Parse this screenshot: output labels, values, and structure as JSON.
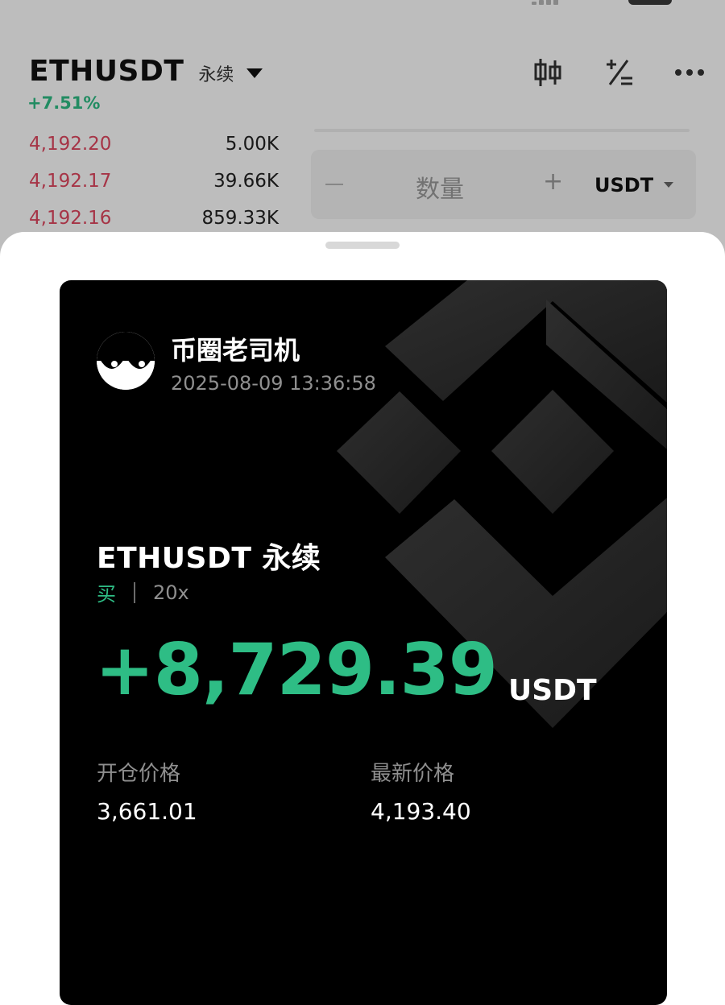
{
  "header": {
    "pair": "ETHUSDT",
    "contract_type": "永续",
    "change_percent": "+7.51%",
    "icons": [
      "candlestick-icon",
      "position-calc-icon",
      "more-icon"
    ]
  },
  "orderbook": {
    "asks": [
      {
        "price": "4,192.20",
        "qty": "5.00K"
      },
      {
        "price": "4,192.17",
        "qty": "39.66K"
      },
      {
        "price": "4,192.16",
        "qty": "859.33K"
      }
    ]
  },
  "order_form": {
    "quantity_placeholder": "数量",
    "minus": "−",
    "plus": "+",
    "unit": "USDT"
  },
  "card": {
    "username": "币圈老司机",
    "timestamp": "2025-08-09 13:36:58",
    "symbol": "ETHUSDT 永续",
    "side": "买",
    "leverage": "20x",
    "pnl": "+8,729.39",
    "pnl_unit": "USDT",
    "entry_label": "开仓价格",
    "entry_price": "3,661.01",
    "latest_label": "最新价格",
    "latest_price": "4,193.40"
  },
  "colors": {
    "up": "#2ebd85",
    "down": "#e0475f",
    "card_bg": "#000000"
  }
}
